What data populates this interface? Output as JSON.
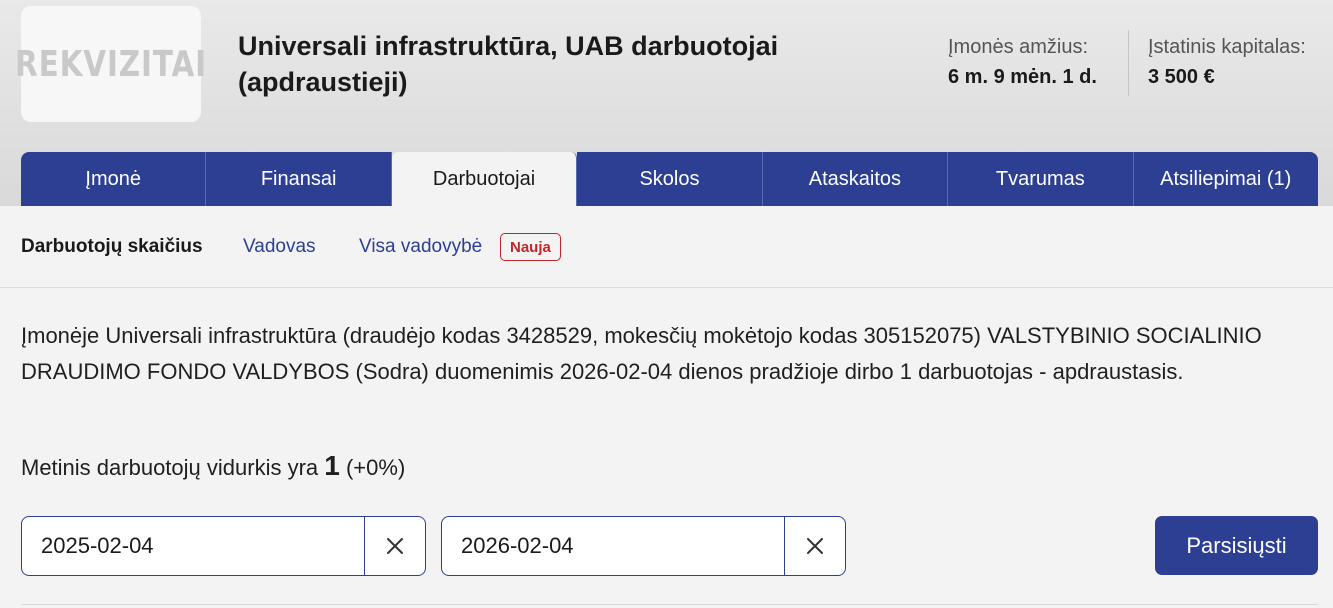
{
  "logo": {
    "text": "REKVIZITAI"
  },
  "header": {
    "title": "Universali infrastruktūra, UAB darbuotojai (apdraustieji)",
    "age_label": "Įmonės amžius:",
    "age_value": "6 m. 9 mėn. 1 d.",
    "capital_label": "Įstatinis kapitalas:",
    "capital_value": "3 500 €"
  },
  "tabs": [
    {
      "label": "Įmonė",
      "active": false
    },
    {
      "label": "Finansai",
      "active": false
    },
    {
      "label": "Darbuotojai",
      "active": true
    },
    {
      "label": "Skolos",
      "active": false
    },
    {
      "label": "Ataskaitos",
      "active": false
    },
    {
      "label": "Tvarumas",
      "active": false
    },
    {
      "label": "Atsiliepimai (1)",
      "active": false
    }
  ],
  "subnav": {
    "active": "Darbuotojų skaičius",
    "link1": "Vadovas",
    "link2": "Visa vadovybė",
    "badge": "Nauja"
  },
  "content": {
    "paragraph": "Įmonėje Universali infrastruktūra (draudėjo kodas 3428529, mokesčių mokėtojo kodas 305152075) VALSTYBINIO SOCIALINIO DRAUDIMO FONDO VALDYBOS (Sodra) duomenimis 2026-02-04 dienos pradžioje dirbo 1 darbuotojas - apdraustasis.",
    "avg_prefix": "Metinis darbuotojų vidurkis yra",
    "avg_value": "1",
    "avg_change": "(+0%)"
  },
  "filters": {
    "date_from": "2025-02-04",
    "date_to": "2026-02-04",
    "clear_icon": "close-icon",
    "download_label": "Parsisiųsti"
  },
  "colors": {
    "primary": "#2c3f93",
    "badge": "#c0272d"
  }
}
